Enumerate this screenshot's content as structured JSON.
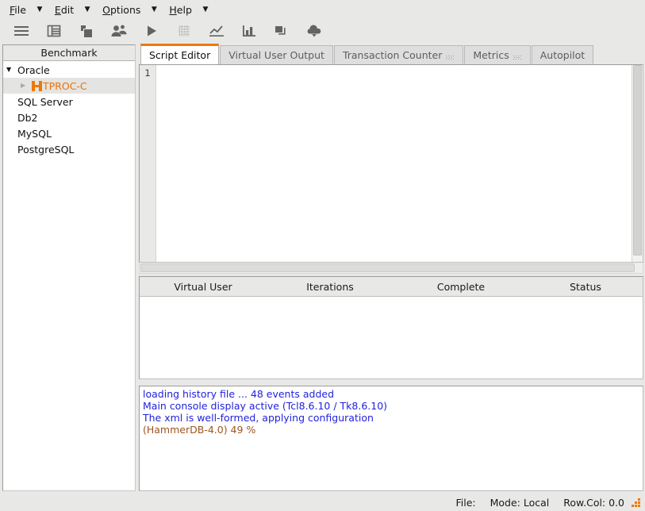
{
  "menubar": {
    "items": [
      {
        "label": "File",
        "mnemonic": "F",
        "arrow": "▼"
      },
      {
        "label": "Edit",
        "mnemonic": "E",
        "arrow": "▼"
      },
      {
        "label": "Options",
        "mnemonic": "O",
        "arrow": "▼"
      },
      {
        "label": "Help",
        "mnemonic": "H",
        "arrow": "▼"
      }
    ]
  },
  "toolbar": {
    "buttons": [
      {
        "name": "hamburger-menu-icon",
        "title": "Benchmark Options"
      },
      {
        "name": "grid-icon",
        "title": "Schema Build"
      },
      {
        "name": "load-script-icon",
        "title": "Load Script"
      },
      {
        "name": "virtual-users-icon",
        "title": "Virtual Users"
      },
      {
        "name": "play-icon",
        "title": "Run"
      },
      {
        "name": "stop-icon",
        "title": "Stop",
        "disabled": true
      },
      {
        "name": "line-chart-icon",
        "title": "Transaction Counter"
      },
      {
        "name": "bar-chart-icon",
        "title": "Metrics"
      },
      {
        "name": "cascade-windows-icon",
        "title": "Autopilot"
      },
      {
        "name": "upload-cloud-icon",
        "title": "Publish"
      }
    ]
  },
  "sidebar": {
    "header": "Benchmark",
    "tree": [
      {
        "label": "Oracle",
        "level": 1,
        "twisty": "▼",
        "expanded": true,
        "selected": false,
        "logo": false
      },
      {
        "label": "TPROC-C",
        "level": 2,
        "twisty": "▶",
        "expanded": false,
        "selected": true,
        "logo": true
      },
      {
        "label": "SQL Server",
        "level": 1,
        "twisty": "",
        "expanded": false,
        "selected": false,
        "logo": false
      },
      {
        "label": "Db2",
        "level": 1,
        "twisty": "",
        "expanded": false,
        "selected": false,
        "logo": false
      },
      {
        "label": "MySQL",
        "level": 1,
        "twisty": "",
        "expanded": false,
        "selected": false,
        "logo": false
      },
      {
        "label": "PostgreSQL",
        "level": 1,
        "twisty": "",
        "expanded": false,
        "selected": false,
        "logo": false
      }
    ]
  },
  "tabs": [
    {
      "label": "Script Editor",
      "active": true,
      "icon": false
    },
    {
      "label": "Virtual User Output",
      "active": false,
      "icon": false
    },
    {
      "label": "Transaction Counter",
      "active": false,
      "icon": true
    },
    {
      "label": "Metrics",
      "active": false,
      "icon": true
    },
    {
      "label": "Autopilot",
      "active": false,
      "icon": false
    }
  ],
  "editor": {
    "line_numbers": [
      "1"
    ],
    "content": ""
  },
  "virtual_user_table": {
    "columns": [
      "Virtual User",
      "Iterations",
      "Complete",
      "Status"
    ],
    "rows": []
  },
  "console": {
    "lines": [
      {
        "text": "loading history file ... 48 events added",
        "type": "info"
      },
      {
        "text": "Main console display active (Tcl8.6.10 / Tk8.6.10)",
        "type": "info"
      },
      {
        "text": "The xml is well-formed, applying configuration",
        "type": "info"
      },
      {
        "text": "(HammerDB-4.0) 49 %",
        "type": "prompt"
      }
    ]
  },
  "statusbar": {
    "file_label": "File:",
    "mode_label": "Mode: Local",
    "rowcol_label": "Row.Col: 0.0",
    "grip": "resize-grip-icon"
  },
  "colors": {
    "accent": "#f07800",
    "window_bg": "#e8e8e6",
    "panel_bg": "#ffffff",
    "log_info": "#2222dd",
    "log_prompt": "#9c5520"
  }
}
